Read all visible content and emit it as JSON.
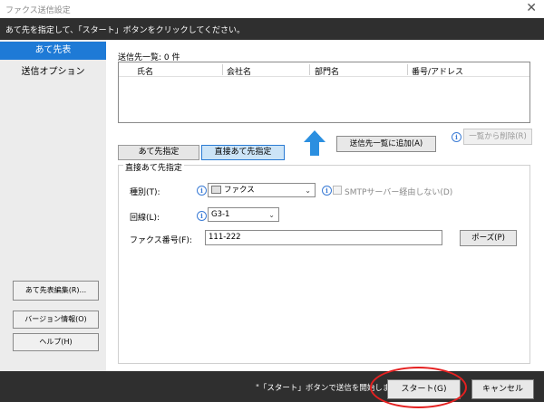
{
  "window": {
    "title": "ファクス送信設定",
    "close_glyph": "✕"
  },
  "instruction": "あて先を指定して、「スタート」ボタンをクリックしてください。",
  "sidebar": {
    "tabs": [
      {
        "label": "あて先表",
        "active": true
      },
      {
        "label": "送信オプション",
        "active": false
      }
    ],
    "buttons": {
      "address_book_edit": "あて先表編集(R)...",
      "version_info": "バージョン情報(O)",
      "help": "ヘルプ(H)"
    }
  },
  "recipient_list": {
    "heading": "送信先一覧: 0 件",
    "columns": [
      "氏名",
      "会社名",
      "部門名",
      "番号/アドレス"
    ],
    "rows": []
  },
  "actions": {
    "add_to_list": "送信先一覧に追加(A)",
    "remove_from_list": "一覧から削除(R)"
  },
  "tabs": [
    {
      "label": "あて先指定",
      "active": false
    },
    {
      "label": "直接あて先指定",
      "active": true
    }
  ],
  "direct": {
    "group_title": "直接あて先指定",
    "type_label": "種別(T):",
    "type_value": "ファクス",
    "smtp_label": "SMTPサーバー経由しない(D)",
    "line_label": "回線(L):",
    "line_value": "G3-1",
    "fax_label": "ファクス番号(F):",
    "fax_value": "111-222",
    "pause_button": "ポーズ(P)"
  },
  "footer": {
    "message": "\"「スタート」ボタンで送信を開始します。",
    "start_button": "スタート(G)",
    "cancel_button": "キャンセル"
  },
  "colors": {
    "accent": "#1e7ad6",
    "dark_bar": "#2f2f2f",
    "arrow": "#2b8fe0",
    "annotation": "#e52020"
  }
}
